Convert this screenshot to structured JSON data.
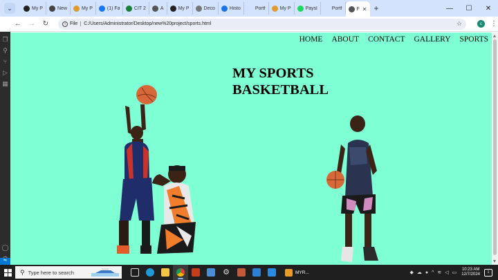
{
  "browser": {
    "tabs": [
      {
        "label": "My P",
        "color": "#222222",
        "icon": "web-icon"
      },
      {
        "label": "New",
        "color": "#444444",
        "icon": "web-icon"
      },
      {
        "label": "My P",
        "color": "#e09b2d",
        "icon": "web-icon"
      },
      {
        "label": "(1) Fa",
        "color": "#1877f2",
        "icon": "facebook-icon"
      },
      {
        "label": "CIT 2",
        "color": "#188038",
        "icon": "sheets-icon"
      },
      {
        "label": "A",
        "color": "#555555",
        "icon": "web-icon"
      },
      {
        "label": "My P",
        "color": "#222222",
        "icon": "web-icon"
      },
      {
        "label": "Deco",
        "color": "#777777",
        "icon": "web-icon"
      },
      {
        "label": "Histo",
        "color": "#1a73e8",
        "icon": "history-icon"
      },
      {
        "label": "Portf",
        "color": "#d3e3fd",
        "icon": "web-icon"
      },
      {
        "label": "My P",
        "color": "#e09b2d",
        "icon": "web-icon"
      },
      {
        "label": "Paysl",
        "color": "#1ed760",
        "icon": "spotify-icon"
      },
      {
        "label": "Portf",
        "color": "#d3e3fd",
        "icon": "web-icon"
      },
      {
        "label": "F",
        "color": "#555555",
        "icon": "web-icon",
        "active": true
      }
    ],
    "new_tab": "+",
    "scheme": "File",
    "url": "C:/Users/Administrator/Desktop/new%20project/sports.html",
    "profile_initial": "c"
  },
  "page": {
    "background": "#7fffd4",
    "nav": [
      "HOME",
      "ABOUT",
      "CONTACT",
      "GALLERY",
      "SPORTS"
    ],
    "headline_line1": "MY SPORTS",
    "headline_line2": "BASKETBALL"
  },
  "taskbar": {
    "search_placeholder": "Type here to search",
    "app_label": "MYR...",
    "time": "10:23 AM",
    "date": "12/7/2024",
    "notification_count": "1"
  }
}
